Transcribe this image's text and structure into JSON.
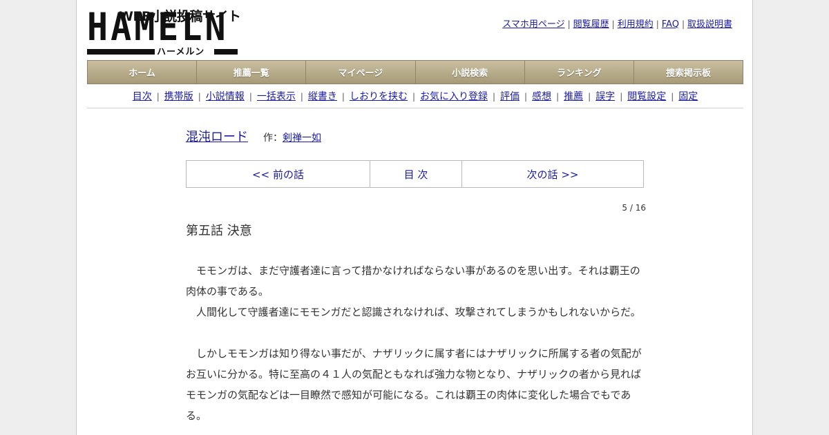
{
  "logo": {
    "tagline": "WEB小説投稿サイト",
    "wordmark": "HAMELN",
    "kana": "ハーメルン"
  },
  "top_links": [
    "スマホ用ページ",
    "閲覧履歴",
    "利用規約",
    "FAQ",
    "取扱説明書"
  ],
  "nav": [
    "ホーム",
    "推薦一覧",
    "マイページ",
    "小説検索",
    "ランキング",
    "捜索掲示板"
  ],
  "subnav": [
    "目次",
    "携帯版",
    "小説情報",
    "一括表示",
    "縦書き",
    "しおりを挟む",
    "お気に入り登録",
    "評価",
    "感想",
    "推薦",
    "誤字",
    "閲覧設定",
    "固定"
  ],
  "novel": {
    "title": "混沌ロード",
    "author_prefix": "作：",
    "author": "剣禅一如"
  },
  "pager": {
    "prev": "<< 前の話",
    "toc": "目 次",
    "next": "次の話 >>"
  },
  "counter": "5 / 16",
  "chapter_title": "第五話 決意",
  "body_lines": [
    "　モモンガは、まだ守護者達に言って措かなければならない事があるのを思い出す。それは覇王の",
    "肉体の事である。",
    "　人間化して守護者達にモモンガだと認識されなければ、攻撃されてしまうかもしれないからだ。",
    "",
    "　しかしモモンガは知り得ない事だが、ナザリックに属す者にはナザリックに所属する者の気配が",
    "お互いに分かる。特に至高の４１人の気配ともなれば強力な物となり、ナザリックの者から見れば",
    "モモンガの気配などは一目瞭然で感知が可能になる。これは覇王の肉体に変化した場合でもであ",
    "る。"
  ]
}
